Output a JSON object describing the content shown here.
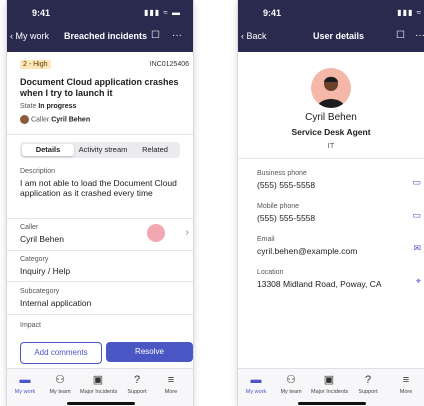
{
  "left": {
    "status_time": "9:41",
    "status_icons": "▮▮▮ ≈ ▬",
    "nav": {
      "back_label": "My work",
      "title": "Breached incidents",
      "bookmark_icon": "bookmark-icon",
      "more_label": "···"
    },
    "priority_badge": "2 - High",
    "incident_number": "INC0125406",
    "incident_title": "Document Cloud application crashes when I try to launch it",
    "state_label": "State",
    "state_value": "In progress",
    "caller_label": "Caller",
    "caller_name": "Cyril Behen",
    "tabs": [
      "Details",
      "Activity stream",
      "Related"
    ],
    "description": {
      "label": "Description",
      "value": "I am not able to load the Document Cloud application as it crashed every time"
    },
    "caller_field": {
      "label": "Caller",
      "value": "Cyril Behen"
    },
    "category": {
      "label": "Category",
      "value": "Inquiry / Help"
    },
    "subcategory": {
      "label": "Subcategory",
      "value": "Internal application"
    },
    "impact": {
      "label": "Impact"
    },
    "buttons": {
      "add_comments": "Add comments",
      "resolve": "Resolve"
    },
    "tabbar": [
      {
        "label": "My work",
        "icon": "briefcase-icon"
      },
      {
        "label": "My team",
        "icon": "team-icon"
      },
      {
        "label": "Major Incidents",
        "icon": "incident-icon"
      },
      {
        "label": "Support",
        "icon": "help-icon"
      },
      {
        "label": "More",
        "icon": "menu-icon"
      }
    ]
  },
  "right": {
    "status_time": "9:41",
    "status_icons": "▮▮▮ ≈",
    "nav": {
      "back_label": "Back",
      "title": "User details",
      "bookmark_icon": "bookmark-icon",
      "more_label": "···"
    },
    "user_name": "Cyril Behen",
    "user_role": "Service Desk Agent",
    "user_dept": "IT",
    "fields": [
      {
        "label": "Business phone",
        "value": "(555) 555-5558",
        "icon": "message-icon"
      },
      {
        "label": "Mobile phone",
        "value": "(555) 555-5558",
        "icon": "message-icon"
      },
      {
        "label": "Email",
        "value": "cyril.behen@example.com",
        "icon": "email-icon"
      },
      {
        "label": "Location",
        "value": "13308 Midland Road, Poway, CA",
        "icon": "location-icon"
      }
    ],
    "tabbar": [
      {
        "label": "My work",
        "icon": "briefcase-icon"
      },
      {
        "label": "My team",
        "icon": "team-icon"
      },
      {
        "label": "Major Incidents",
        "icon": "incident-icon"
      },
      {
        "label": "Support",
        "icon": "help-icon"
      },
      {
        "label": "More",
        "icon": "menu-icon"
      }
    ]
  },
  "colors": {
    "nav_bg": "#292a4e",
    "accent": "#4b56c5",
    "badge_bg": "#fde6b8"
  }
}
